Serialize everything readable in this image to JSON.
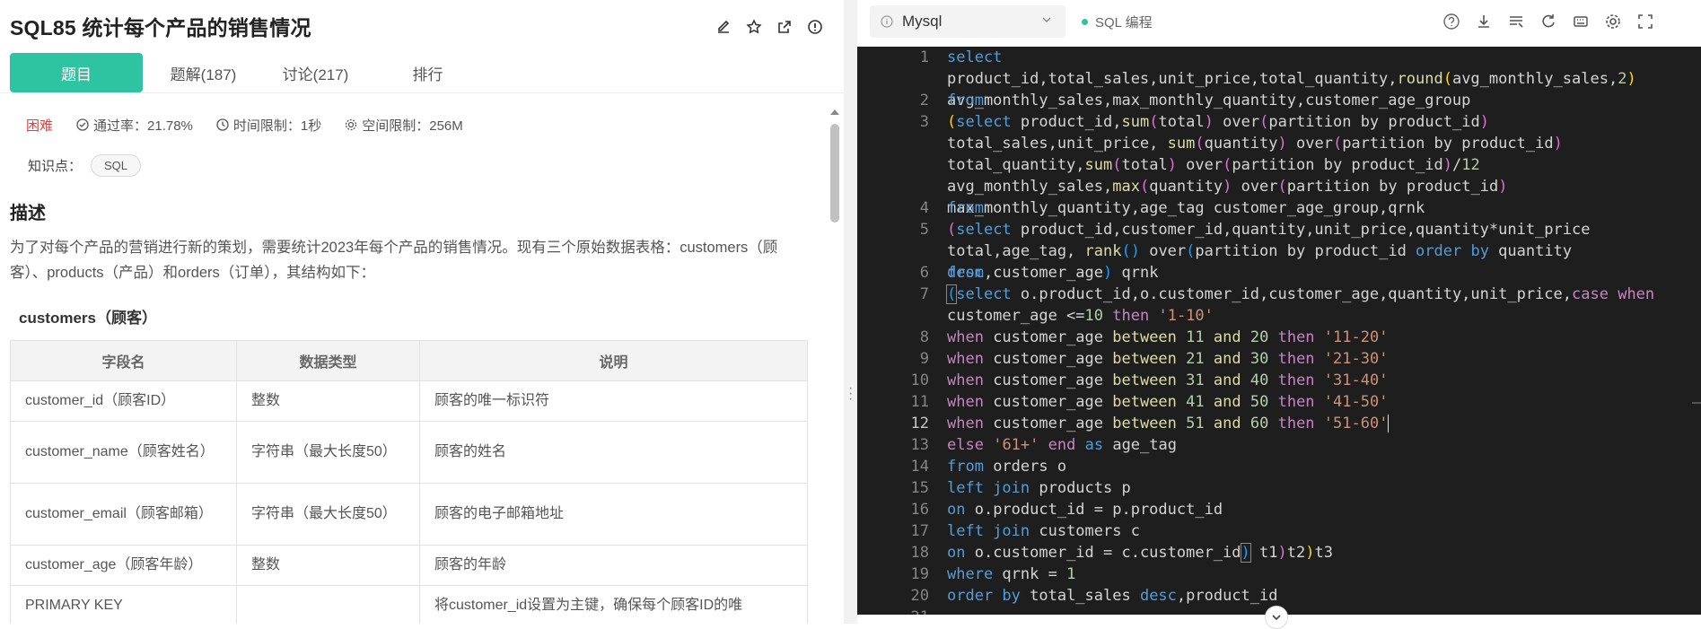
{
  "problem": {
    "title": "SQL85  统计每个产品的销售情况",
    "tabs": [
      "题目",
      "题解(187)",
      "讨论(217)",
      "排行"
    ],
    "difficulty": "困难",
    "pass_rate": "通过率：21.78%",
    "time_limit": "时间限制：1秒",
    "space_limit": "空间限制：256M",
    "knowledge_label": "知识点：",
    "knowledge_tag": "SQL",
    "desc_title": "描述",
    "description": "为了对每个产品的营销进行新的策划，需要统计2023年每个产品的销售情况。现有三个原始数据表格：customers（顾客）、products（产品）和orders（订单），其结构如下：",
    "table_title": "customers（顾客）",
    "table_headers": [
      "字段名",
      "数据类型",
      "说明"
    ],
    "table_rows": [
      [
        "customer_id（顾客ID）",
        "整数",
        "顾客的唯一标识符"
      ],
      [
        "customer_name（顾客姓名）",
        "字符串（最大长度50）",
        "顾客的姓名"
      ],
      [
        "customer_email（顾客邮箱）",
        "字符串（最大长度50）",
        "顾客的电子邮箱地址"
      ],
      [
        "customer_age（顾客年龄）",
        "整数",
        "顾客的年龄"
      ],
      [
        "PRIMARY KEY",
        "",
        "将customer_id设置为主键，确保每个顾客ID的唯"
      ]
    ]
  },
  "editor": {
    "language": "Mysql",
    "mode": "SQL 编程",
    "current_line": 12,
    "icons": [
      "help-icon",
      "download-icon",
      "format-icon",
      "refresh-icon",
      "keyboard-icon",
      "settings-icon",
      "fullscreen-icon"
    ],
    "line_numbers": [
      "1",
      "2",
      "3",
      "4",
      "5",
      "6",
      "7",
      "8",
      "9",
      "10",
      "11",
      "12",
      "13",
      "14",
      "15",
      "16",
      "17",
      "18",
      "19",
      "20",
      "21"
    ],
    "code_lines": [
      "select product_id,total_sales,unit_price,total_quantity,round(avg_monthly_sales,2) avg_monthly_sales,max_monthly_quantity,customer_age_group",
      "from",
      "(select product_id,sum(total) over(partition by product_id) total_sales,unit_price, sum(quantity) over(partition by product_id) total_quantity,sum(total) over(partition by product_id)/12 avg_monthly_sales,max(quantity) over(partition by product_id) max_monthly_quantity,age_tag customer_age_group,qrnk",
      "from",
      "(select product_id,customer_id,quantity,unit_price,quantity*unit_price total,age_tag, rank() over(partition by product_id order by quantity desc,customer_age) qrnk",
      "from",
      "(select o.product_id,o.customer_id,customer_age,quantity,unit_price,case when customer_age <=10 then '1-10'",
      "when customer_age between 11 and 20 then '11-20'",
      "when customer_age between 21 and 30 then '21-30'",
      "when customer_age between 31 and 40 then '31-40'",
      "when customer_age between 41 and 50 then '41-50'",
      "when customer_age between 51 and 60 then '51-60'",
      "else '61+' end as age_tag",
      "from orders o",
      "left join products p",
      "on o.product_id = p.product_id",
      "left join customers c",
      "on o.customer_id = c.customer_id) t1)t2)t3",
      "where qrnk = 1",
      "order by total_sales desc,product_id",
      ""
    ]
  },
  "colors": {
    "accent": "#2fc4a1",
    "difficulty": "#e0403b",
    "editor_bg": "#1e1e1e"
  }
}
